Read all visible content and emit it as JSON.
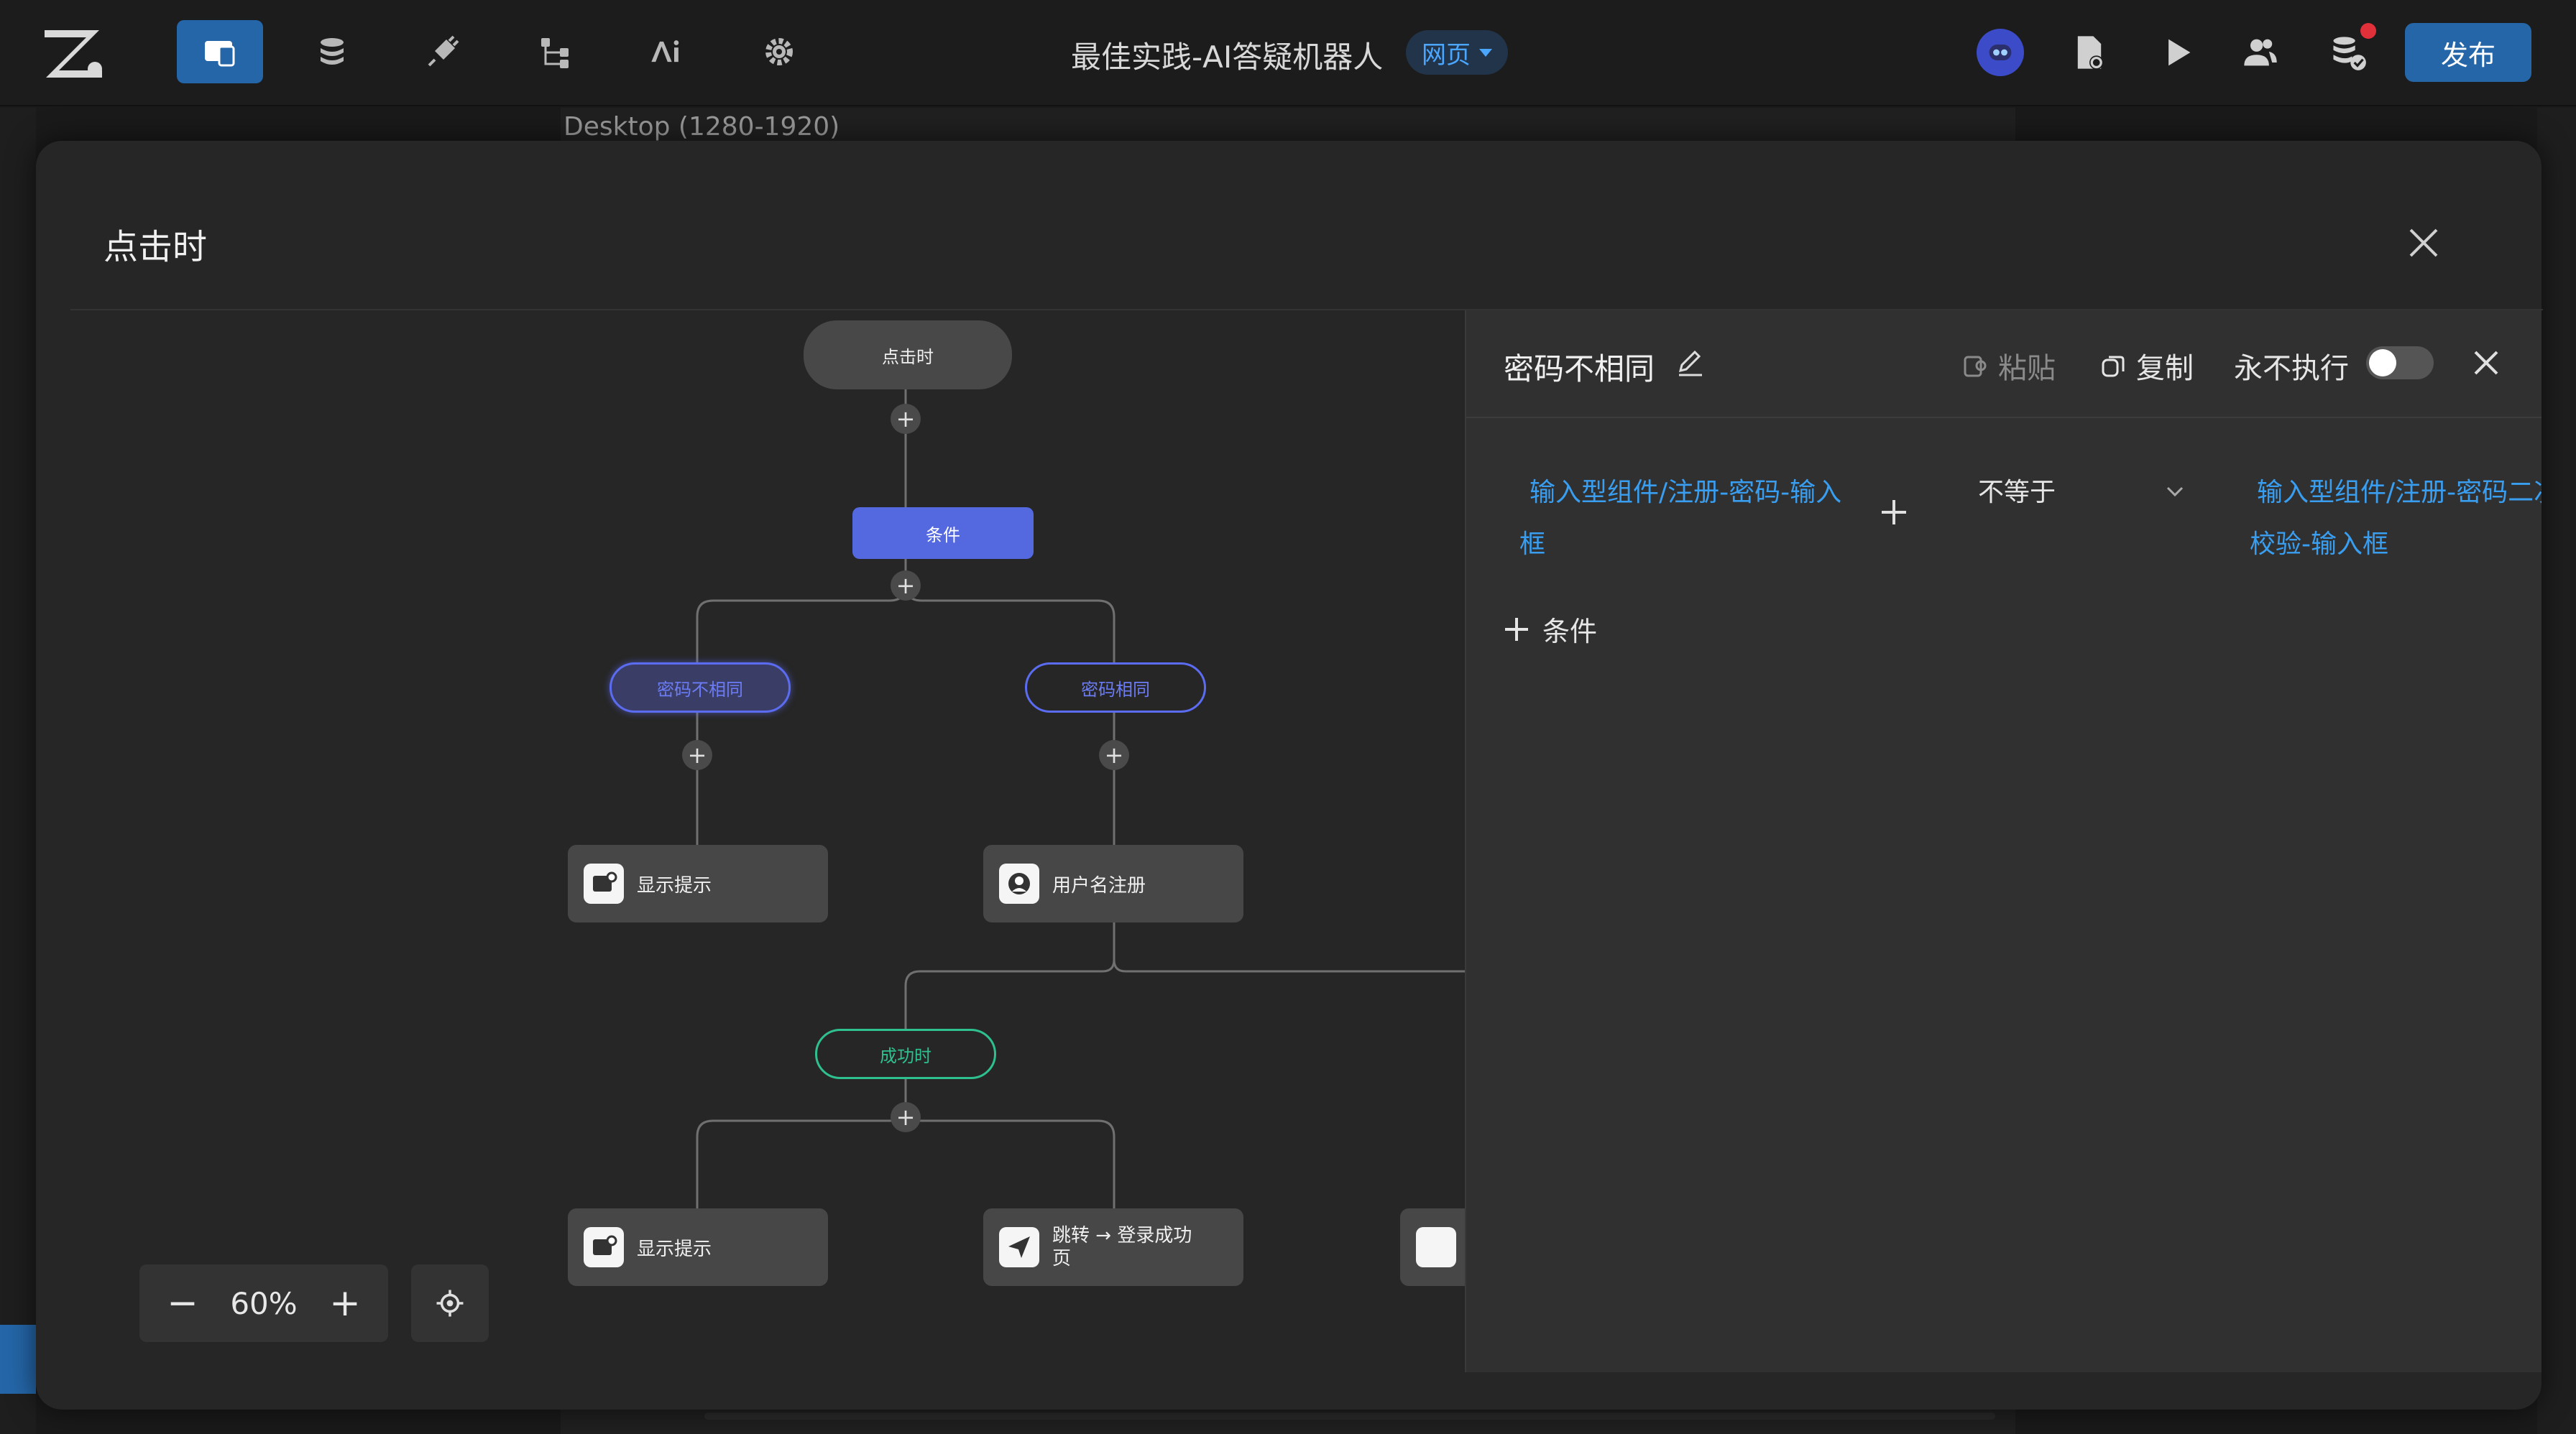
{
  "topbar": {
    "app_title": "最佳实践-AI答疑机器人",
    "platform_badge": "网页",
    "publish_label": "发布",
    "icons": [
      "logo-icon",
      "page-design-icon",
      "database-icon",
      "plugin-icon",
      "workflow-icon",
      "ai-icon",
      "settings-icon",
      "assistant-icon",
      "page-settings-icon",
      "preview-icon",
      "users-icon",
      "data-check-icon"
    ],
    "accent": "#2466a8"
  },
  "underlay": {
    "device_label": "Desktop (1280-1920)"
  },
  "modal": {
    "title": "点击时"
  },
  "flow": {
    "start_label": "点击时",
    "condition_label": "条件",
    "branch_left": "密码不相同",
    "branch_right": "密码相同",
    "card_show_tip_1": "显示提示",
    "card_register": "用户名注册",
    "success_label": "成功时",
    "card_show_tip_2": "显示提示",
    "card_jump_line1": "跳转 → 登录成功",
    "card_jump_line2": "页",
    "colors": {
      "condition": "#5468e0",
      "branch_border": "#5b6cf0",
      "success_border": "#2fc08f"
    }
  },
  "zoom": {
    "minus": "−",
    "value": "60%",
    "plus": "+"
  },
  "panel": {
    "title": "密码不相同",
    "paste_label": "粘贴",
    "copy_label": "复制",
    "never_execute_label": "永不执行",
    "never_execute_on": false,
    "condition": {
      "left_operand_line1": "输入型组件/注册-密码-输入",
      "left_operand_line2": "框",
      "operator": "不等于",
      "right_operand_line1": "输入型组件/注册-密码二次",
      "right_operand_line2": "校验-输入框"
    },
    "add_condition_label": "条件"
  }
}
